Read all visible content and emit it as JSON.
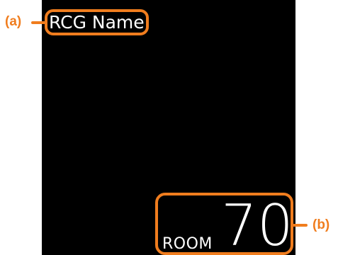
{
  "display": {
    "name": "RCG Name.",
    "room_label": "ROOM",
    "room_number": "70"
  },
  "callouts": {
    "a": "(a)",
    "b": "(b)"
  },
  "colors": {
    "screen_background": "#000000",
    "highlight": "#f07d1e",
    "text": "#ffffff"
  }
}
